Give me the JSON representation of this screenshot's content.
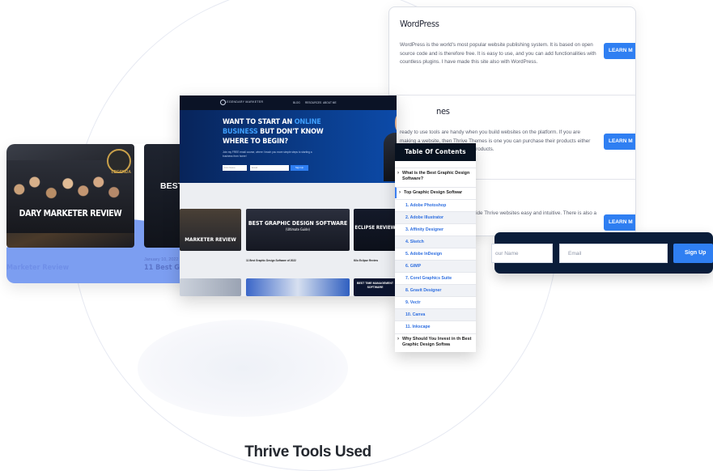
{
  "wordpress_card": {
    "sections": [
      {
        "title": "WordPress",
        "text": "WordPress is the world's most popular website publishing system. It is based on open source code and is therefore free. It is easy to use, and you can add functionalities with countless plugins. I have made this site also with WordPress.",
        "button": "LEARN M"
      },
      {
        "title": "nes",
        "text": "ready to use tools are handy when you build websites on the platform. If you are making a website, then Thrive Themes is one you can purchase their products either membership that qualifies for all products.",
        "button": "LEARN M"
      },
      {
        "title": "",
        "text": "ress page builder software alongside Thrive websites easy and intuitive. There is also a free",
        "button": "LEARN M"
      }
    ]
  },
  "blog_card": {
    "post1": {
      "image_text": "DARY MARKETER REVIEW",
      "badge": "LEGENDA",
      "caption": "Marketer Review"
    },
    "post2": {
      "image_text": "BEST",
      "date": "January 10, 2022",
      "caption": "11 Best Gra"
    }
  },
  "site_preview": {
    "nav": {
      "logo": "LEGENDARY MARKETER",
      "links": [
        "BLOG",
        "RESOURCES",
        "ABOUT ME"
      ]
    },
    "hero": {
      "line1_a": "WANT TO START AN ",
      "line1_b": "ONLINE",
      "line2_a": "BUSINESS",
      "line2_b": " BUT DON'T KNOW",
      "line3": "WHERE TO BEGIN?",
      "sub": "Join my FREE email course, where I teach you more simple steps to starting a business from home!",
      "input1": "First Name",
      "input2": "Email",
      "button": "Sign Up"
    },
    "posts": [
      {
        "thumb": "MARKETER REVIEW",
        "caption": ""
      },
      {
        "thumb": "BEST GRAPHIC DESIGN SOFTWARE",
        "thumb_sub": "(Ultimate Guide)",
        "caption": "11 Best Graphic Design Software of 2022"
      },
      {
        "thumb": "ECLIPSE REVIEW",
        "caption": "Kilo Eclipse Review"
      }
    ],
    "bottom_thumb": "BEST TIME MANAGEMENT SOFTWARE"
  },
  "toc": {
    "title": "Table Of Contents",
    "q1": "What is the Best Graphic Design Software?",
    "q2": "Top Graphic Design Softwar",
    "items": [
      "1. Adobe Photoshop",
      "2. Adobe Illustrator",
      "3. Affinity Designer",
      "4. Sketch",
      "5. Adobe InDesign",
      "6. GIMP",
      "7. Corel Graphics Suite",
      "8. Gravit Designer",
      "9. Vectr",
      "10. Canva",
      "11. Inkscape"
    ],
    "q3": "Why Should You Invest in th Best Graphic Design Softwa"
  },
  "signup": {
    "name_placeholder": "our Name",
    "email_placeholder": "Email",
    "button": "Sign Up"
  },
  "section_title": "Thrive Tools Used"
}
